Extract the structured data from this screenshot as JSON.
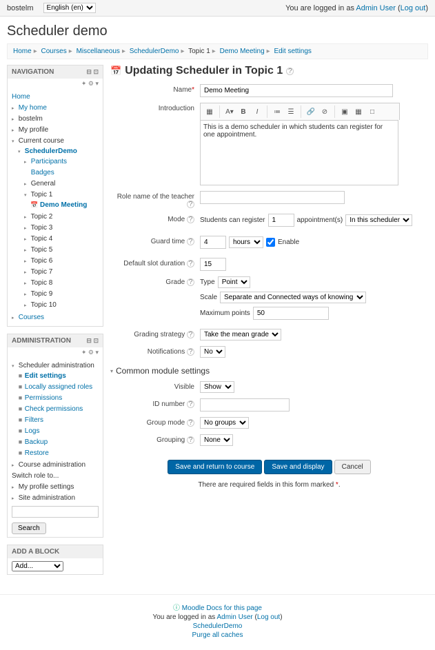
{
  "topbar": {
    "brand": "bostelm",
    "lang_options": [
      "English (en)"
    ],
    "logged_prefix": "You are logged in as ",
    "admin_user": "Admin User",
    "logout": "Log out"
  },
  "page_title": "Scheduler demo",
  "breadcrumbs": [
    "Home",
    "Courses",
    "Miscellaneous",
    "SchedulerDemo",
    "Topic 1",
    "Demo Meeting",
    "Edit settings"
  ],
  "nav": {
    "title": "NAVIGATION",
    "home": "Home",
    "items": [
      "My home",
      "bostelm",
      "My profile"
    ],
    "current_course": "Current course",
    "scheduler_demo": "SchedulerDemo",
    "sd_children": [
      "Participants",
      "Badges",
      "General"
    ],
    "topic1": "Topic 1",
    "demo_meeting": "Demo Meeting",
    "topics": [
      "Topic 2",
      "Topic 3",
      "Topic 4",
      "Topic 5",
      "Topic 6",
      "Topic 7",
      "Topic 8",
      "Topic 9",
      "Topic 10"
    ],
    "courses": "Courses"
  },
  "admin": {
    "title": "ADMINISTRATION",
    "sched_admin": "Scheduler administration",
    "sched_items": [
      "Edit settings",
      "Locally assigned roles",
      "Permissions",
      "Check permissions",
      "Filters",
      "Logs",
      "Backup",
      "Restore"
    ],
    "course_admin": "Course administration",
    "switch_role": "Switch role to...",
    "profile_settings": "My profile settings",
    "site_admin": "Site administration",
    "search": "Search"
  },
  "add_block": {
    "title": "ADD A BLOCK",
    "placeholder": "Add..."
  },
  "form": {
    "title": "Updating Scheduler in Topic 1",
    "name_label": "Name",
    "name_value": "Demo Meeting",
    "intro_label": "Introduction",
    "intro_value": "This is a demo scheduler in which students can register for one appointment.",
    "role_label": "Role name of the teacher",
    "mode_label": "Mode",
    "mode_pre": "Students can register",
    "mode_val": "1",
    "mode_mid": "appointment(s)",
    "mode_scope": "In this scheduler",
    "guard_label": "Guard time",
    "guard_val": "4",
    "guard_unit": "hours",
    "guard_enable": "Enable",
    "slot_label": "Default slot duration",
    "slot_val": "15",
    "grade_label": "Grade",
    "grade_type_lbl": "Type",
    "grade_type": "Point",
    "grade_scale_lbl": "Scale",
    "grade_scale": "Separate and Connected ways of knowing",
    "grade_max_lbl": "Maximum points",
    "grade_max": "50",
    "strategy_label": "Grading strategy",
    "strategy_val": "Take the mean grade",
    "notif_label": "Notifications",
    "notif_val": "No",
    "common_hd": "Common module settings",
    "visible_label": "Visible",
    "visible_val": "Show",
    "idnum_label": "ID number",
    "groupmode_label": "Group mode",
    "groupmode_val": "No groups",
    "grouping_label": "Grouping",
    "grouping_val": "None",
    "btn_save_return": "Save and return to course",
    "btn_save_display": "Save and display",
    "btn_cancel": "Cancel",
    "req_note": "There are required fields in this form marked "
  },
  "footer": {
    "docs": "Moodle Docs for this page",
    "logged_prefix": "You are logged in as ",
    "admin_user": "Admin User",
    "logout": "Log out",
    "course": "SchedulerDemo",
    "purge": "Purge all caches"
  }
}
